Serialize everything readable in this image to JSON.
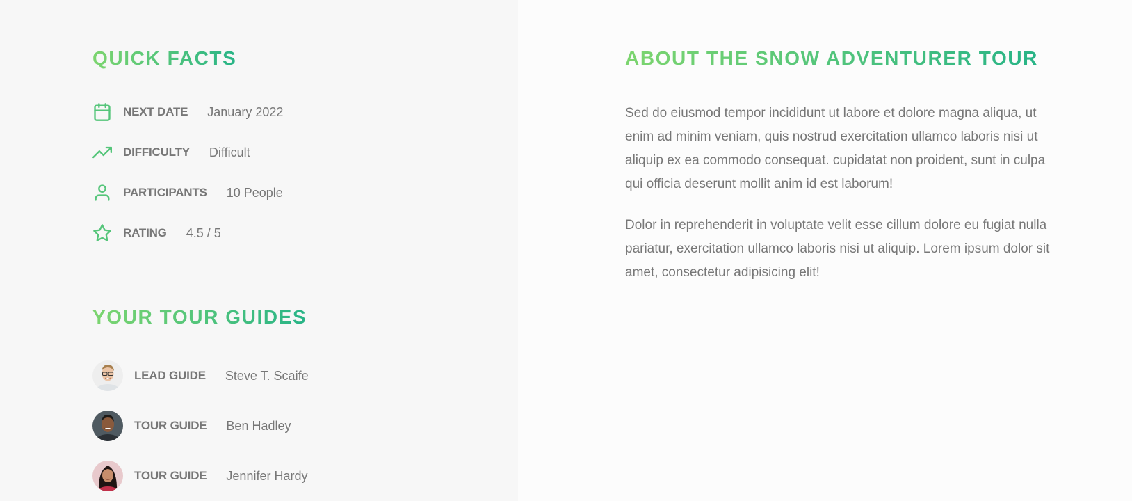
{
  "quick_facts": {
    "title": "Quick Facts",
    "items": [
      {
        "icon": "calendar-icon",
        "label": "NEXT DATE",
        "value": "January 2022"
      },
      {
        "icon": "trending-up-icon",
        "label": "DIFFICULTY",
        "value": "Difficult"
      },
      {
        "icon": "user-icon",
        "label": "PARTICIPANTS",
        "value": "10 People"
      },
      {
        "icon": "star-icon",
        "label": "RATING",
        "value": "4.5 / 5"
      }
    ]
  },
  "tour_guides": {
    "title": "Your Tour Guides",
    "items": [
      {
        "role": "LEAD GUIDE",
        "name": "Steve T. Scaife"
      },
      {
        "role": "TOUR GUIDE",
        "name": "Ben Hadley"
      },
      {
        "role": "TOUR GUIDE",
        "name": "Jennifer Hardy"
      }
    ]
  },
  "about": {
    "title": "About the Snow Adventurer Tour",
    "paragraphs": [
      "Sed do eiusmod tempor incididunt ut labore et dolore magna aliqua, ut enim ad minim veniam, quis nostrud exercitation ullamco laboris nisi ut aliquip ex ea commodo consequat. cupidatat non proident, sunt in culpa qui officia deserunt mollit anim id est laborum!",
      "Dolor in reprehenderit in voluptate velit esse cillum dolore eu fugiat nulla pariatur, exercitation ullamco laboris nisi ut aliquip. Lorem ipsum dolor sit amet, consectetur adipisicing elit!"
    ]
  },
  "colors": {
    "accent_start": "#7dd56f",
    "accent_end": "#28b487",
    "text": "#777777",
    "left_bg": "#f7f7f7",
    "right_bg": "#fcfcfc"
  }
}
